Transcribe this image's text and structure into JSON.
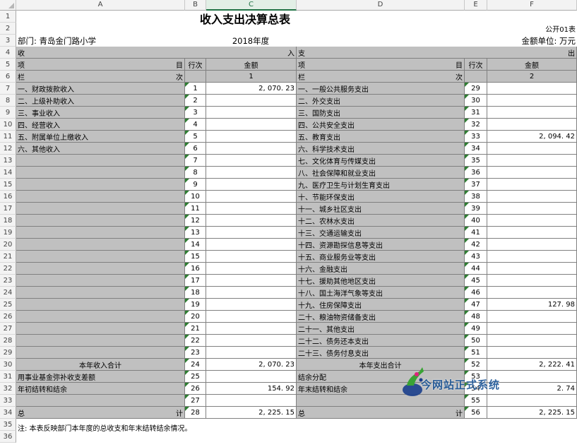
{
  "columns": [
    "A",
    "B",
    "C",
    "D",
    "E",
    "F"
  ],
  "selected_column": "C",
  "rows": [
    "1",
    "2",
    "3",
    "4",
    "5",
    "6",
    "7",
    "8",
    "9",
    "10",
    "11",
    "12",
    "13",
    "14",
    "15",
    "16",
    "17",
    "18",
    "19",
    "20",
    "21",
    "22",
    "23",
    "24",
    "25",
    "26",
    "27",
    "28",
    "29",
    "30",
    "31",
    "32",
    "33",
    "34",
    "35",
    "36"
  ],
  "header": {
    "title": "收入支出决算总表",
    "form_no": "公开01表",
    "department": "部门: 青岛金门路小学",
    "year": "2018年度",
    "unit": "金额单位: 万元",
    "income": "收",
    "income_right": "入",
    "expense": "支",
    "expense_right": "出",
    "item": "项",
    "item_right": "目",
    "rowno": "行次",
    "amount": "金额",
    "col": "栏",
    "col_right": "次",
    "col1": "1",
    "col2": "2"
  },
  "income_rows": [
    {
      "label": "一、财政拨款收入",
      "no": "1",
      "amount": "2, 070. 23"
    },
    {
      "label": "二、上级补助收入",
      "no": "2",
      "amount": ""
    },
    {
      "label": "三、事业收入",
      "no": "3",
      "amount": ""
    },
    {
      "label": "四、经营收入",
      "no": "4",
      "amount": ""
    },
    {
      "label": "五、附属单位上缴收入",
      "no": "5",
      "amount": ""
    },
    {
      "label": "六、其他收入",
      "no": "6",
      "amount": ""
    },
    {
      "label": "",
      "no": "7",
      "amount": ""
    },
    {
      "label": "",
      "no": "8",
      "amount": ""
    },
    {
      "label": "",
      "no": "9",
      "amount": ""
    },
    {
      "label": "",
      "no": "10",
      "amount": ""
    },
    {
      "label": "",
      "no": "11",
      "amount": ""
    },
    {
      "label": "",
      "no": "12",
      "amount": ""
    },
    {
      "label": "",
      "no": "13",
      "amount": ""
    },
    {
      "label": "",
      "no": "14",
      "amount": ""
    },
    {
      "label": "",
      "no": "15",
      "amount": ""
    },
    {
      "label": "",
      "no": "16",
      "amount": ""
    },
    {
      "label": "",
      "no": "17",
      "amount": ""
    },
    {
      "label": "",
      "no": "18",
      "amount": ""
    },
    {
      "label": "",
      "no": "19",
      "amount": ""
    },
    {
      "label": "",
      "no": "20",
      "amount": ""
    },
    {
      "label": "",
      "no": "21",
      "amount": ""
    },
    {
      "label": "",
      "no": "22",
      "amount": ""
    },
    {
      "label": "",
      "no": "23",
      "amount": ""
    }
  ],
  "expense_rows": [
    {
      "label": "一、一般公共服务支出",
      "no": "29",
      "amount": ""
    },
    {
      "label": "二、外交支出",
      "no": "30",
      "amount": ""
    },
    {
      "label": "三、国防支出",
      "no": "31",
      "amount": ""
    },
    {
      "label": "四、公共安全支出",
      "no": "32",
      "amount": ""
    },
    {
      "label": "五、教育支出",
      "no": "33",
      "amount": "2, 094. 42"
    },
    {
      "label": "六、科学技术支出",
      "no": "34",
      "amount": ""
    },
    {
      "label": "七、文化体育与传媒支出",
      "no": "35",
      "amount": ""
    },
    {
      "label": "八、社会保障和就业支出",
      "no": "36",
      "amount": ""
    },
    {
      "label": "九、医疗卫生与计划生育支出",
      "no": "37",
      "amount": ""
    },
    {
      "label": "十、节能环保支出",
      "no": "38",
      "amount": ""
    },
    {
      "label": "十一、城乡社区支出",
      "no": "39",
      "amount": ""
    },
    {
      "label": "十二、农林水支出",
      "no": "40",
      "amount": ""
    },
    {
      "label": "十三、交通运输支出",
      "no": "41",
      "amount": ""
    },
    {
      "label": "十四、资源勘探信息等支出",
      "no": "42",
      "amount": ""
    },
    {
      "label": "十五、商业服务业等支出",
      "no": "43",
      "amount": ""
    },
    {
      "label": "十六、金融支出",
      "no": "44",
      "amount": ""
    },
    {
      "label": "十七、援助其他地区支出",
      "no": "45",
      "amount": ""
    },
    {
      "label": "十八、国土海洋气象等支出",
      "no": "46",
      "amount": ""
    },
    {
      "label": "十九、住房保障支出",
      "no": "47",
      "amount": "127. 98"
    },
    {
      "label": "二十、粮油物资储备支出",
      "no": "48",
      "amount": ""
    },
    {
      "label": "二十一、其他支出",
      "no": "49",
      "amount": ""
    },
    {
      "label": "二十二、债务还本支出",
      "no": "50",
      "amount": ""
    },
    {
      "label": "二十三、债务付息支出",
      "no": "51",
      "amount": ""
    }
  ],
  "totals": [
    {
      "left_label": "本年收入合计",
      "left_no": "24",
      "left_amount": "2, 070. 23",
      "right_label": "本年支出合计",
      "right_no": "52",
      "right_amount": "2, 222. 41"
    },
    {
      "left_label": "用事业基金弥补收支差额",
      "left_no": "25",
      "left_amount": "",
      "right_label": "结余分配",
      "right_no": "53",
      "right_amount": ""
    },
    {
      "left_label": "年初结转和结余",
      "left_no": "26",
      "left_amount": "154. 92",
      "right_label": "年末结转和结余",
      "right_no": "54",
      "right_amount": "2. 74"
    },
    {
      "left_label": "",
      "left_no": "27",
      "left_amount": "",
      "right_label": "",
      "right_no": "55",
      "right_amount": ""
    }
  ],
  "grand_total": {
    "left": "总",
    "left_right": "计",
    "left_no": "28",
    "left_amount": "2, 225. 15",
    "right": "总",
    "right_right": "计",
    "right_no": "56",
    "right_amount": "2, 225. 15"
  },
  "note": "注: 本表反映部门本年度的总收支和年末结转结余情况。",
  "watermark": "今网站正式系统"
}
